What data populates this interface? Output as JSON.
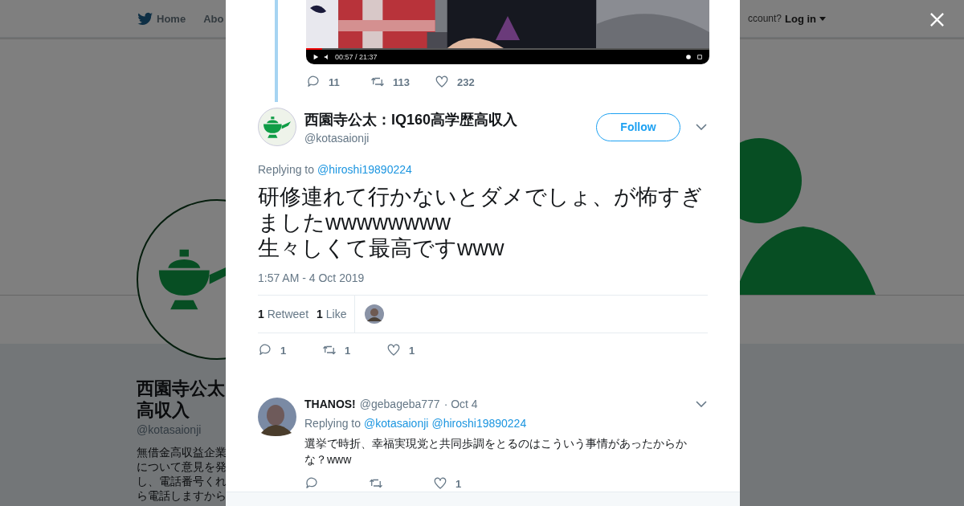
{
  "background_page": {
    "nav": {
      "items": [
        {
          "label": "Home"
        },
        {
          "label": "Abo"
        }
      ],
      "account_prompt": "ccount?",
      "login": "Log in"
    },
    "profile": {
      "name_lines": [
        "西園寺公太",
        "高収入"
      ],
      "handle": "@kotasaionji",
      "bio_lines": [
        "無借金高収益企業",
        "について意見を発",
        "し、電話番号くれ",
        "ら電話しますから"
      ]
    }
  },
  "thread_tweet": {
    "video": {
      "time": "00:57 / 21:37",
      "level": 0.04
    },
    "actions": [
      {
        "kind": "reply",
        "count": "11"
      },
      {
        "kind": "retweet",
        "count": "113"
      },
      {
        "kind": "like",
        "count": "232"
      }
    ]
  },
  "tweet": {
    "display_name": "西園寺公太：IQ160高学歴高収入",
    "handle": "@kotasaionji",
    "follow_button": "Follow",
    "replying_to_label": "Replying to",
    "replying_to": [
      "@hiroshi19890224"
    ],
    "text": "研修連れて行かないとダメでしょ、が怖すぎましたwwwwwwww\n生々しくて最高ですwww",
    "timestamp": "1:57 AM - 4 Oct 2019",
    "stats": [
      {
        "count": "1",
        "label": "Retweet"
      },
      {
        "count": "1",
        "label": "Like"
      }
    ],
    "actions": [
      {
        "kind": "reply",
        "count": "1"
      },
      {
        "kind": "retweet",
        "count": "1"
      },
      {
        "kind": "like",
        "count": "1"
      }
    ]
  },
  "replies": [
    {
      "display_name": "THANOS!",
      "handle": "@gebageba777",
      "date": "· Oct 4",
      "replying_to_label": "Replying to",
      "replying_to": [
        "@kotasaionji",
        "@hiroshi19890224"
      ],
      "text": "選挙で時折、幸福実現党と共同歩調をとるのはこういう事情があったからかな？www",
      "actions": [
        {
          "kind": "reply"
        },
        {
          "kind": "retweet"
        },
        {
          "kind": "like",
          "count": "1"
        }
      ]
    }
  ]
}
